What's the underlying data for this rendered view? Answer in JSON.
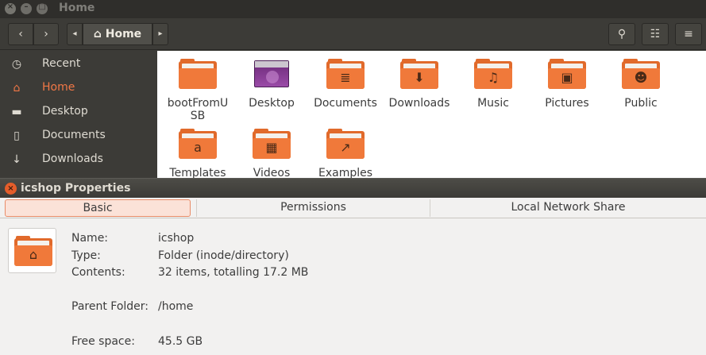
{
  "file_manager": {
    "title": "Home",
    "toolbar": {
      "back_icon": "‹",
      "forward_icon": "›",
      "path_prev_icon": "◂",
      "path_next_icon": "▸",
      "path_home_icon": "⌂",
      "path_label": "Home",
      "search_icon": "⚲",
      "view_icon": "☷",
      "menu_icon": "≡"
    },
    "sidebar": {
      "items": [
        {
          "label": "Recent",
          "icon": "◷"
        },
        {
          "label": "Home",
          "icon": "⌂"
        },
        {
          "label": "Desktop",
          "icon": "▬"
        },
        {
          "label": "Documents",
          "icon": "▯"
        },
        {
          "label": "Downloads",
          "icon": "↓"
        }
      ]
    },
    "files": [
      {
        "label": "bootFromU\nSB",
        "emblem": ""
      },
      {
        "label": "Desktop",
        "emblem": ""
      },
      {
        "label": "Documents",
        "emblem": "≣"
      },
      {
        "label": "Downloads",
        "emblem": "⬇"
      },
      {
        "label": "Music",
        "emblem": "♫"
      },
      {
        "label": "Pictures",
        "emblem": "▣"
      },
      {
        "label": "Public",
        "emblem": "☻"
      },
      {
        "label": "Templates",
        "emblem": "a"
      },
      {
        "label": "Videos",
        "emblem": "▦"
      },
      {
        "label": "Examples",
        "emblem": "↗"
      }
    ]
  },
  "dialog": {
    "title": "icshop Properties",
    "close_icon": "×",
    "tabs": [
      "Basic",
      "Permissions",
      "Local Network Share"
    ],
    "folder_emblem": "⌂",
    "properties": [
      {
        "label": "Name:",
        "value": "icshop"
      },
      {
        "label": "Type:",
        "value": "Folder (inode/directory)"
      },
      {
        "label": "Contents:",
        "value": "32 items, totalling 17.2 MB"
      },
      {
        "label": "Parent Folder:",
        "value": "/home"
      },
      {
        "label": "Free space:",
        "value": "45.5 GB"
      }
    ]
  },
  "colors": {
    "accent": "#f07746",
    "folder": "#f0793a",
    "chrome": "#3c3b37"
  }
}
